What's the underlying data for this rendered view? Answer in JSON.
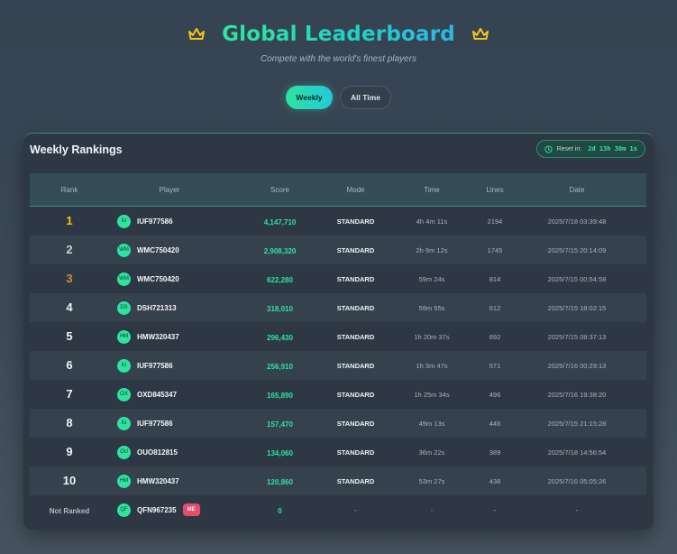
{
  "header": {
    "title": "Global Leaderboard",
    "subtitle": "Compete with the world's finest players",
    "crown_icon": "crown-icon",
    "crown_color": "#f5c518"
  },
  "tabs": [
    {
      "label": "Weekly",
      "active": true
    },
    {
      "label": "All Time",
      "active": false
    }
  ],
  "panel": {
    "title": "Weekly Rankings",
    "reset_label": "Reset in:",
    "reset_time": "2d 13h 30m 1s",
    "clock_icon": "clock-icon"
  },
  "columns": [
    "Rank",
    "Player",
    "Score",
    "Mode",
    "Time",
    "Lines",
    "Date"
  ],
  "colors": {
    "accent": "#2ee39e",
    "gold": "#f5c518",
    "silver": "#c9cfd6",
    "bronze": "#d98a2e",
    "me_badge": "#e84b6b"
  },
  "rows": [
    {
      "rank": "1",
      "avatar": "IU",
      "player": "IUF977586",
      "score": "4,147,710",
      "mode": "STANDARD",
      "time": "4h 4m 11s",
      "lines": "2194",
      "date": "2025/7/18 03:39:48"
    },
    {
      "rank": "2",
      "avatar": "WM",
      "player": "WMC750420",
      "score": "2,908,320",
      "mode": "STANDARD",
      "time": "2h 9m 12s",
      "lines": "1745",
      "date": "2025/7/15 20:14:09"
    },
    {
      "rank": "3",
      "avatar": "WM",
      "player": "WMC750420",
      "score": "622,280",
      "mode": "STANDARD",
      "time": "59m 24s",
      "lines": "814",
      "date": "2025/7/15 00:54:58"
    },
    {
      "rank": "4",
      "avatar": "DS",
      "player": "DSH721313",
      "score": "318,010",
      "mode": "STANDARD",
      "time": "59m 55s",
      "lines": "612",
      "date": "2025/7/15 18:02:15"
    },
    {
      "rank": "5",
      "avatar": "HM",
      "player": "HMW320437",
      "score": "296,430",
      "mode": "STANDARD",
      "time": "1h 20m 37s",
      "lines": "692",
      "date": "2025/7/15 08:37:13"
    },
    {
      "rank": "6",
      "avatar": "IU",
      "player": "IUF977586",
      "score": "256,910",
      "mode": "STANDARD",
      "time": "1h 3m 47s",
      "lines": "571",
      "date": "2025/7/16 00:29:13"
    },
    {
      "rank": "7",
      "avatar": "OX",
      "player": "OXD845347",
      "score": "165,890",
      "mode": "STANDARD",
      "time": "1h 25m 34s",
      "lines": "496",
      "date": "2025/7/16 19:38:20"
    },
    {
      "rank": "8",
      "avatar": "IU",
      "player": "IUF977586",
      "score": "157,470",
      "mode": "STANDARD",
      "time": "49m 13s",
      "lines": "446",
      "date": "2025/7/15 21:15:28"
    },
    {
      "rank": "9",
      "avatar": "OU",
      "player": "OUO812815",
      "score": "134,060",
      "mode": "STANDARD",
      "time": "36m 22s",
      "lines": "389",
      "date": "2025/7/18 14:56:54"
    },
    {
      "rank": "10",
      "avatar": "HM",
      "player": "HMW320437",
      "score": "120,860",
      "mode": "STANDARD",
      "time": "53m 27s",
      "lines": "438",
      "date": "2025/7/16 05:05:26"
    }
  ],
  "me_row": {
    "rank": "Not Ranked",
    "avatar": "QF",
    "player": "QFN967235",
    "badge": "ME",
    "score": "0",
    "mode": "-",
    "time": "-",
    "lines": "-",
    "date": "-"
  }
}
